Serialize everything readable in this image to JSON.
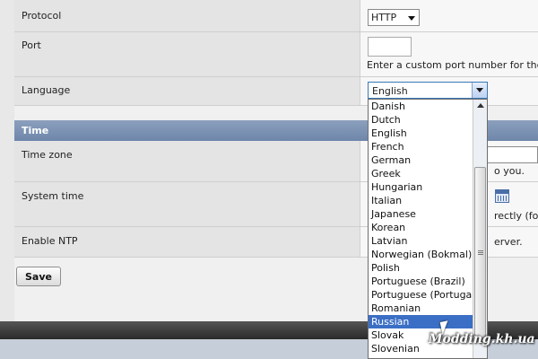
{
  "settings": {
    "protocol": {
      "label": "Protocol",
      "value": "HTTP"
    },
    "port": {
      "label": "Port",
      "value": "",
      "hint": "Enter a custom port number for the Wel"
    },
    "language": {
      "label": "Language",
      "value": "English",
      "options": [
        "Danish",
        "Dutch",
        "English",
        "French",
        "German",
        "Greek",
        "Hungarian",
        "Italian",
        "Japanese",
        "Korean",
        "Latvian",
        "Norwegian (Bokmal)",
        "Polish",
        "Portuguese (Brazil)",
        "Portuguese (Portugal)",
        "Romanian",
        "Russian",
        "Slovak",
        "Slovenian"
      ],
      "highlighted": "Russian"
    }
  },
  "time_section": {
    "title": "Time",
    "time_zone": {
      "label": "Time zone",
      "hint": "o you."
    },
    "system_time": {
      "label": "System time",
      "hint": "rectly (form"
    },
    "ntp": {
      "label": "Enable NTP",
      "hint": "erver."
    }
  },
  "actions": {
    "save_label": "Save"
  },
  "watermark": "Modding.kh.ua",
  "colors": {
    "section_header": "#7a90b3",
    "highlight": "#3b6fc5"
  }
}
